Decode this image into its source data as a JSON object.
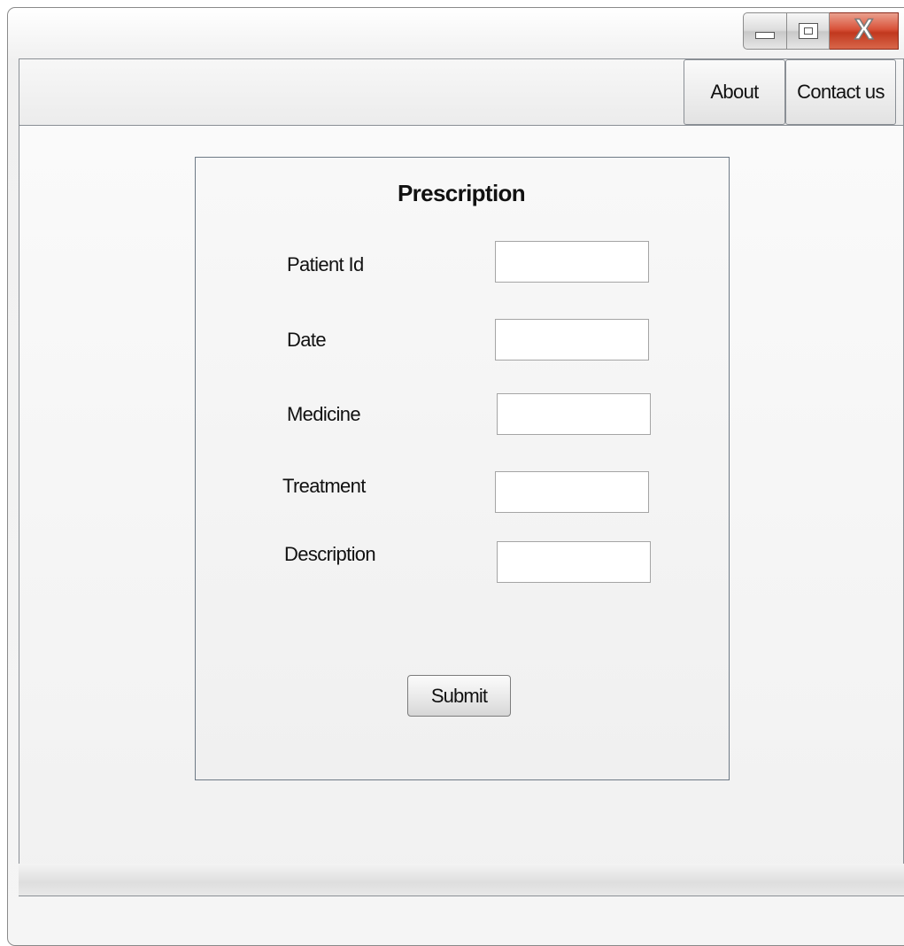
{
  "window": {
    "controls": {
      "minimize_icon": "minimize-icon",
      "maximize_icon": "maximize-icon",
      "close_icon": "close-icon",
      "close_glyph": "X",
      "close_color": "#d9533a"
    }
  },
  "navbar": {
    "items": [
      {
        "label": "About"
      },
      {
        "label": "Contact us"
      }
    ]
  },
  "form": {
    "title": "Prescription",
    "fields": [
      {
        "label": "Patient Id",
        "value": ""
      },
      {
        "label": "Date",
        "value": ""
      },
      {
        "label": "Medicine",
        "value": ""
      },
      {
        "label": "Treatment",
        "value": ""
      },
      {
        "label": "Description",
        "value": ""
      }
    ],
    "submit_label": "Submit"
  }
}
